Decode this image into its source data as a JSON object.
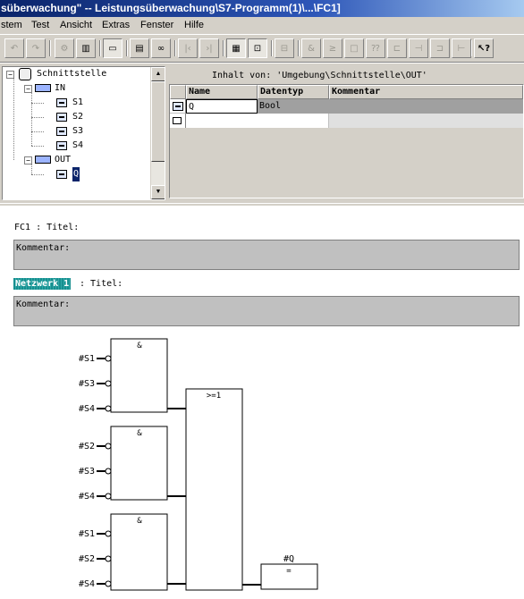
{
  "window": {
    "title": "süberwachung\" -- Leistungsüberwachung\\S7-Programm(1)\\...\\FC1]"
  },
  "menu": [
    "stem",
    "Test",
    "Ansicht",
    "Extras",
    "Fenster",
    "Hilfe"
  ],
  "toolbar": {
    "icons": [
      "undo-icon",
      "redo-icon",
      "compile-icon",
      "download-icon",
      "monitor-icon",
      "network-icon",
      "glasses-icon",
      "left-end-icon",
      "right-end-icon",
      "overview-icon",
      "zoom-icon",
      "program-elements-icon",
      "and-box-icon",
      "or-box-icon",
      "empty-box-icon",
      "unknown-box-icon",
      "branch-icon",
      "contact-icon",
      "coil-icon",
      "wire-icon",
      "help-icon"
    ]
  },
  "tree": {
    "root": "Schnittstelle",
    "items": [
      "IN",
      "S1",
      "S2",
      "S3",
      "S4",
      "OUT",
      "Q"
    ]
  },
  "interface": {
    "path": "Inhalt von: 'Umgebung\\Schnittstelle\\OUT'",
    "columns": [
      "Name",
      "Datentyp",
      "Kommentar"
    ],
    "rows": [
      {
        "name": "Q",
        "type": "Bool",
        "comment": ""
      }
    ]
  },
  "editor": {
    "block_title": "FC1 : Titel:",
    "block_comment": "Kommentar:",
    "network_label": "Netzwerk 1",
    "network_title": ": Titel:",
    "network_comment": "Kommentar:",
    "and_symbol": "&",
    "or_symbol": ">=1",
    "assign_symbol": "=",
    "output_operand": "#Q",
    "and_blocks": [
      {
        "inputs": [
          "#S1",
          "#S3",
          "#S4"
        ]
      },
      {
        "inputs": [
          "#S2",
          "#S3",
          "#S4"
        ]
      },
      {
        "inputs": [
          "#S1",
          "#S2",
          "#S4"
        ]
      }
    ]
  }
}
